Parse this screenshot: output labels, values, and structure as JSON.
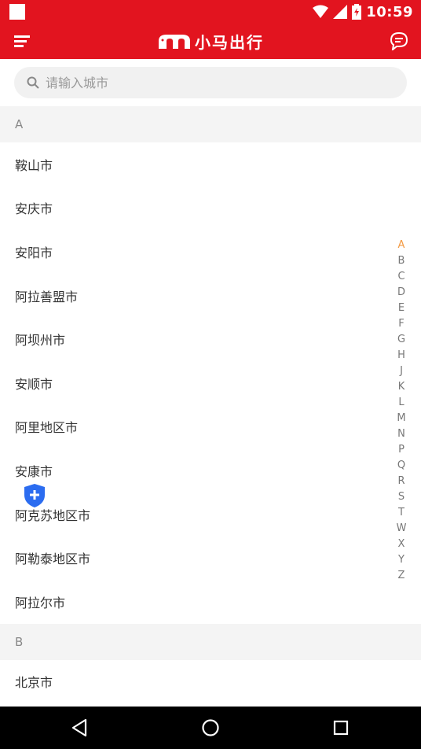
{
  "status_bar": {
    "time": "10:59",
    "icons": [
      "wifi-icon",
      "cell-signal-icon",
      "battery-icon"
    ]
  },
  "app_bar": {
    "logo_text": "小马出行",
    "menu_icon": "menu-icon",
    "chat_icon": "chat-icon"
  },
  "search": {
    "placeholder": "请输入城市"
  },
  "sections": [
    {
      "letter": "A",
      "cities": [
        "鞍山市",
        "安庆市",
        "安阳市",
        "阿拉善盟市",
        "阿坝州市",
        "安顺市",
        "阿里地区市",
        "安康市",
        "阿克苏地区市",
        "阿勒泰地区市",
        "阿拉尔市"
      ]
    },
    {
      "letter": "B",
      "cities": [
        "北京市"
      ]
    }
  ],
  "index_letters": [
    "A",
    "B",
    "C",
    "D",
    "E",
    "F",
    "G",
    "H",
    "J",
    "K",
    "L",
    "M",
    "N",
    "P",
    "Q",
    "R",
    "S",
    "T",
    "W",
    "X",
    "Y",
    "Z"
  ],
  "index_active": "A",
  "colors": {
    "brand_red": "#e2141f",
    "index_active": "#f39a43",
    "fab_blue": "#2b6cf0"
  }
}
